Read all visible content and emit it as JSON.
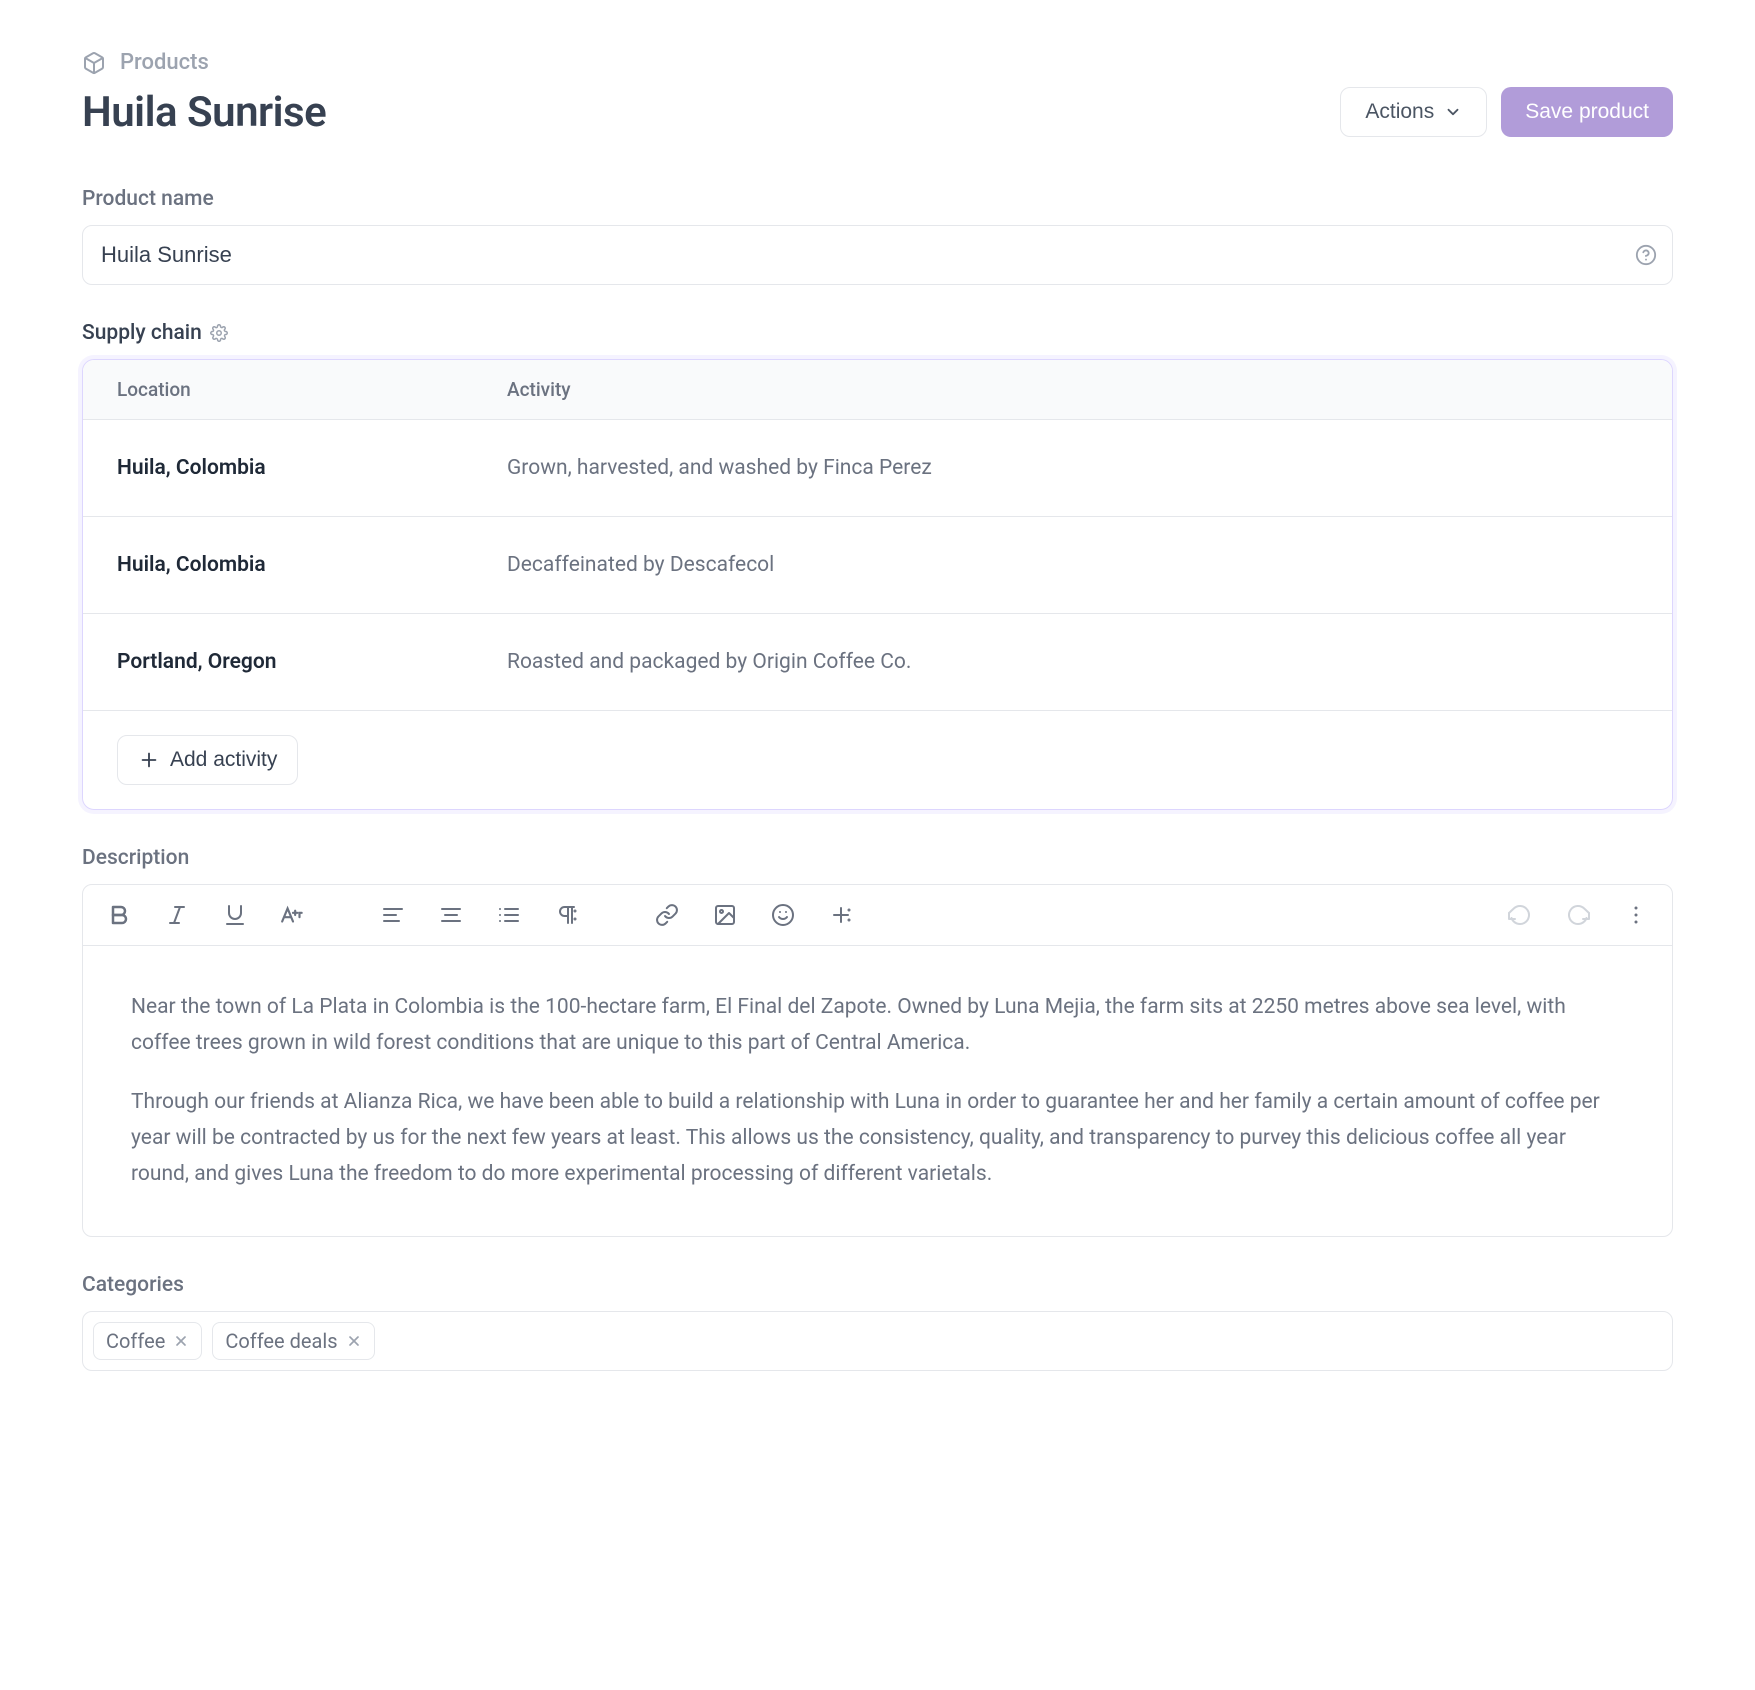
{
  "breadcrumb": {
    "label": "Products"
  },
  "header": {
    "title": "Huila Sunrise",
    "actions_label": "Actions",
    "save_label": "Save product"
  },
  "product_name": {
    "label": "Product name",
    "value": "Huila Sunrise"
  },
  "supply_chain": {
    "label": "Supply chain",
    "headers": {
      "location": "Location",
      "activity": "Activity"
    },
    "rows": [
      {
        "location": "Huila, Colombia",
        "activity": "Grown, harvested, and washed by Finca Perez"
      },
      {
        "location": "Huila, Colombia",
        "activity": "Decaffeinated by Descafecol"
      },
      {
        "location": "Portland, Oregon",
        "activity": "Roasted and packaged by Origin Coffee Co."
      }
    ],
    "add_label": "Add activity"
  },
  "description": {
    "label": "Description",
    "paragraphs": [
      "Near the town of La Plata in Colombia is the 100-hectare farm, El Final del Zapote. Owned by Luna Mejia, the farm sits at 2250 metres above sea level, with coffee trees grown in wild forest conditions that are unique to this part of Central America.",
      "Through our friends at Alianza Rica, we have been able to build a relationship with Luna in order to guarantee her and her family a certain amount of coffee per year will be contracted by us for the next few years at least. This allows us the consistency, quality, and transparency to purvey this delicious coffee all year round, and gives Luna the freedom to do more experimental processing of different varietals."
    ]
  },
  "categories": {
    "label": "Categories",
    "tags": [
      "Coffee",
      "Coffee deals"
    ]
  }
}
